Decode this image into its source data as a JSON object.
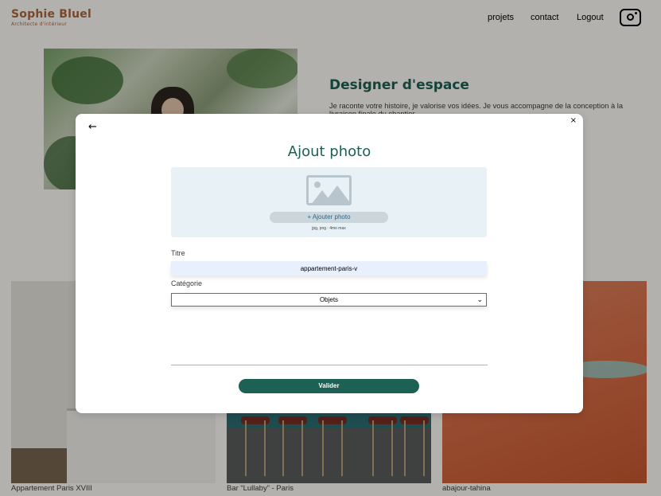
{
  "header": {
    "logo_title": "Sophie Bluel",
    "logo_subtitle": "Architecte d'intérieur",
    "nav": [
      "projets",
      "contact",
      "Logout"
    ],
    "social_icon": "instagram-icon"
  },
  "intro": {
    "title": "Designer d'espace",
    "text": "Je raconte votre histoire, je valorise vos idées. Je vous accompagne de la conception à la livraison finale du chantier."
  },
  "gallery": {
    "captions": [
      "Appartement Paris XVIII",
      "Bar “Lullaby” - Paris",
      "abajour-tahina"
    ]
  },
  "modal": {
    "back_icon": "arrow-left-icon",
    "close_label": "×",
    "title": "Ajout photo",
    "upload_icon": "image-icon",
    "add_photo_label": "+ Ajouter photo",
    "upload_hint": "jpg, png : 4mo max",
    "title_label": "Titre",
    "title_value": "appartement-paris-v",
    "category_label": "Catégorie",
    "category_value": "Objets",
    "submit_label": "Valider"
  },
  "colors": {
    "brand_green": "#1d6154",
    "logo_orange": "#b1663c",
    "upload_bg": "#e8f1f6"
  }
}
